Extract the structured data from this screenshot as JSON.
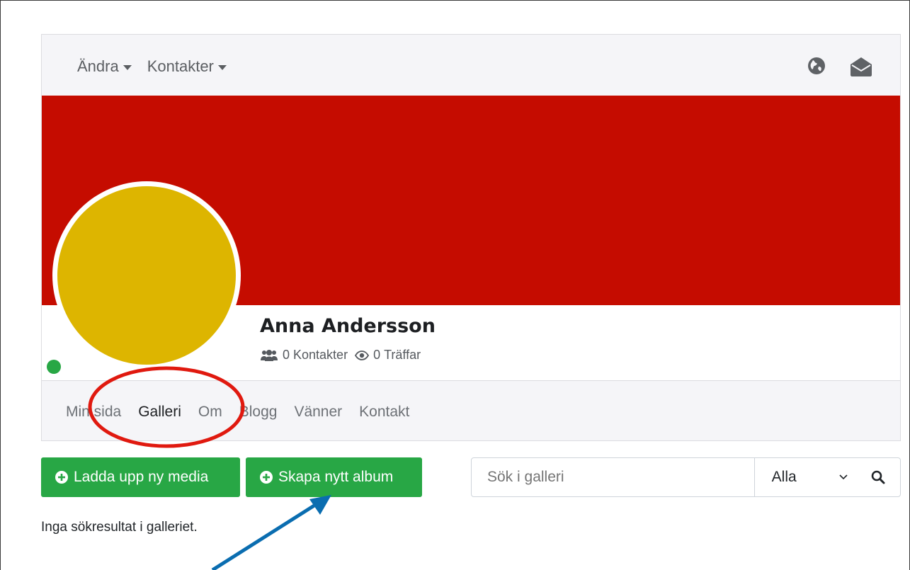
{
  "topnav": {
    "menu": [
      {
        "label": "Ändra"
      },
      {
        "label": "Kontakter"
      }
    ],
    "icons": [
      "globe-icon",
      "envelope-icon"
    ]
  },
  "profile": {
    "name": "Anna Andersson",
    "contacts_count": "0",
    "contacts_label": "Kontakter",
    "views_count": "0",
    "views_label": "Träffar",
    "cover_color": "#c50c00",
    "avatar_color": "#ddb500",
    "online_color": "#28a745"
  },
  "subnav": {
    "tabs": [
      {
        "label": "Min sida"
      },
      {
        "label": "Galleri",
        "active": true
      },
      {
        "label": "Om"
      },
      {
        "label": "Blogg"
      },
      {
        "label": "Vänner"
      },
      {
        "label": "Kontakt"
      }
    ]
  },
  "actions": {
    "upload_label": "Ladda upp ny media",
    "create_album_label": "Skapa nytt album"
  },
  "search": {
    "placeholder": "Sök i galleri",
    "filter_selected": "Alla"
  },
  "gallery": {
    "empty_message": "Inga sökresultat i galleriet."
  },
  "annotations": {
    "ellipse_color": "#e0190f",
    "arrow_color": "#0a6db0"
  }
}
